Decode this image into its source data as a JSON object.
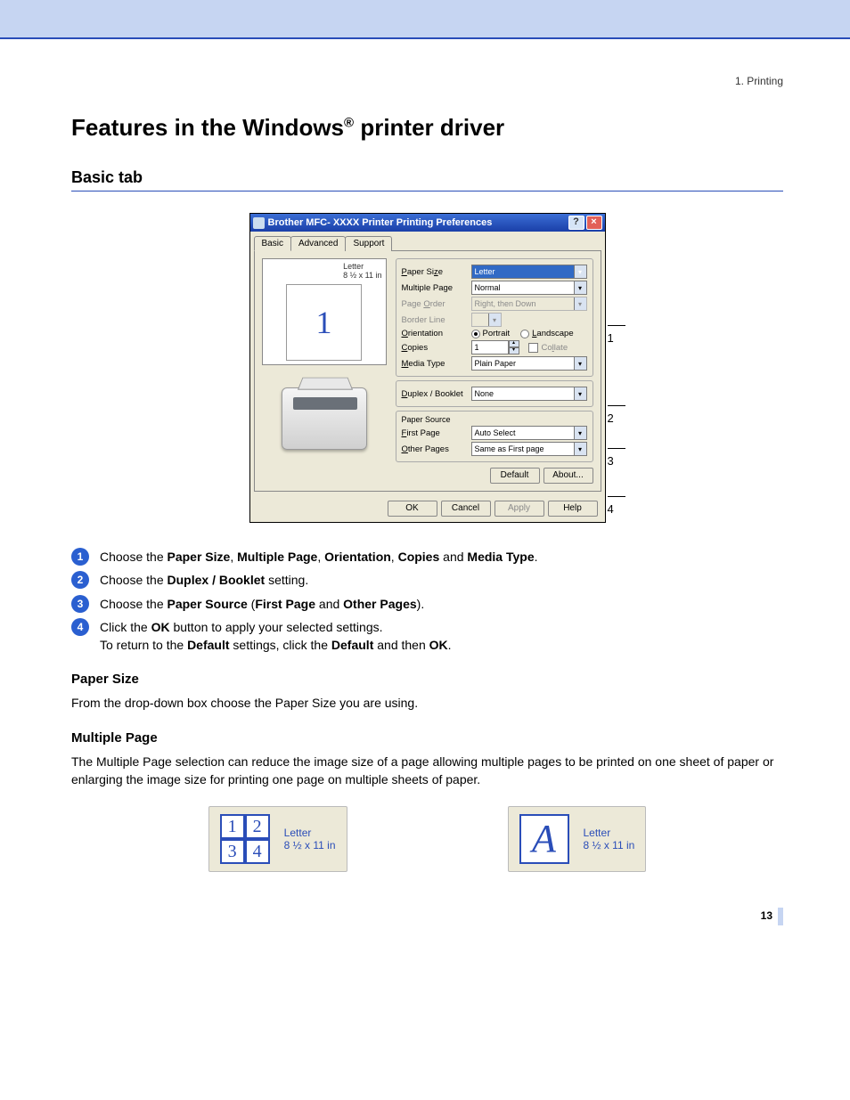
{
  "header": {
    "section": "1. Printing"
  },
  "title": {
    "pre": "Features in the Windows",
    "sup": "®",
    "post": " printer driver"
  },
  "h2": "Basic tab",
  "dialog": {
    "title": "Brother MFC-  XXXX   Printer Printing Preferences",
    "tabs": [
      "Basic",
      "Advanced",
      "Support"
    ],
    "preview": {
      "line1": "Letter",
      "line2": "8 ½ x 11 in",
      "big": "1"
    },
    "fields": {
      "paper_size": {
        "label": "Paper Size",
        "value": "Letter"
      },
      "multiple_page": {
        "label": "Multiple Page",
        "value": "Normal"
      },
      "page_order": {
        "label": "Page Order",
        "value": "Right, then Down"
      },
      "border_line": {
        "label": "Border Line",
        "value": ""
      },
      "orientation": {
        "label": "Orientation",
        "portrait": "Portrait",
        "landscape": "Landscape"
      },
      "copies": {
        "label": "Copies",
        "value": "1",
        "collate": "Collate"
      },
      "media_type": {
        "label": "Media Type",
        "value": "Plain Paper"
      },
      "duplex": {
        "label": "Duplex / Booklet",
        "value": "None"
      },
      "paper_source": {
        "legend": "Paper Source",
        "first": {
          "label": "First Page",
          "value": "Auto Select"
        },
        "other": {
          "label": "Other Pages",
          "value": "Same as First page"
        }
      }
    },
    "buttons": {
      "default": "Default",
      "about": "About...",
      "ok": "OK",
      "cancel": "Cancel",
      "apply": "Apply",
      "help": "Help"
    },
    "callouts": {
      "n1": "1",
      "n2": "2",
      "n3": "3",
      "n4": "4"
    }
  },
  "steps": {
    "s1": {
      "n": "1",
      "pre": "Choose the ",
      "b1": "Paper Size",
      "c1": ", ",
      "b2": "Multiple Page",
      "c2": ", ",
      "b3": "Orientation",
      "c3": ", ",
      "b4": "Copies",
      "c4": " and ",
      "b5": "Media Type",
      "post": "."
    },
    "s2": {
      "n": "2",
      "pre": "Choose the ",
      "b1": "Duplex / Booklet",
      "post": " setting."
    },
    "s3": {
      "n": "3",
      "pre": "Choose the ",
      "b1": "Paper Source",
      "c1": " (",
      "b2": "First Page",
      "c2": " and ",
      "b3": "Other Pages",
      "post": ")."
    },
    "s4": {
      "n": "4",
      "pre": "Click the ",
      "b1": "OK",
      "mid": " button to apply your selected settings.",
      "line2_pre": "To return to the ",
      "line2_b1": "Default",
      "line2_mid": " settings, click the ",
      "line2_b2": "Default",
      "line2_mid2": " and then ",
      "line2_b3": "OK",
      "line2_post": "."
    }
  },
  "sections": {
    "paper_size": {
      "h": "Paper Size",
      "p": "From the drop-down box choose the Paper Size you are using."
    },
    "multiple_page": {
      "h": "Multiple Page",
      "p": "The Multiple Page selection can reduce the image size of a page allowing multiple pages to be printed on one sheet of paper or enlarging the image size for printing one page on multiple sheets of paper."
    }
  },
  "examples": {
    "cells": [
      "1",
      "2",
      "3",
      "4"
    ],
    "bigA": "A",
    "label_line1": "Letter",
    "label_line2": "8 ½ x 11 in"
  },
  "page_number": "13"
}
